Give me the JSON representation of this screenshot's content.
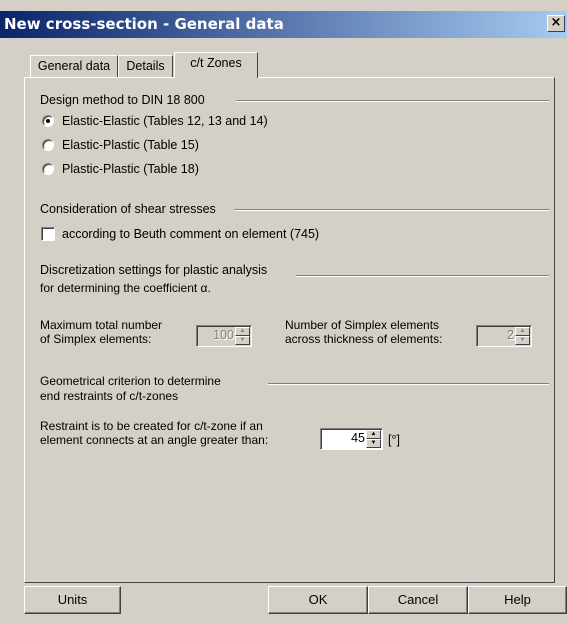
{
  "window": {
    "title": "New cross-section - General data",
    "close_label": "×"
  },
  "tabs": [
    {
      "label": "General data"
    },
    {
      "label": "Details"
    },
    {
      "label": "c/t Zones"
    }
  ],
  "design_method": {
    "heading": "Design method to DIN 18 800",
    "options": [
      {
        "label": "Elastic-Elastic (Tables 12, 13 and 14)",
        "selected": true
      },
      {
        "label": "Elastic-Plastic (Table 15)",
        "selected": false
      },
      {
        "label": "Plastic-Plastic (Table 18)",
        "selected": false
      }
    ]
  },
  "shear": {
    "heading": "Consideration of shear stresses",
    "checkbox_label": "according to Beuth comment on element (745)",
    "checked": false
  },
  "discretization": {
    "heading_line1": "Discretization settings for plastic analysis",
    "heading_line2": "for determining the coefficient α.",
    "max_simplex_label_line1": "Maximum total number",
    "max_simplex_label_line2": "of Simplex elements:",
    "max_simplex_value": "100",
    "across_label_line1": "Number of Simplex elements",
    "across_label_line2": "across thickness of elements:",
    "across_value": "2"
  },
  "geometric": {
    "heading_line1": "Geometrical criterion to determine",
    "heading_line2": "end restraints of c/t-zones",
    "restraint_label_line1": "Restraint is to be created for c/t-zone if an",
    "restraint_label_line2": "element connects at an angle greater than:",
    "angle_value": "45",
    "unit": "[°]"
  },
  "buttons": {
    "units": "Units",
    "ok": "OK",
    "cancel": "Cancel",
    "help": "Help"
  }
}
